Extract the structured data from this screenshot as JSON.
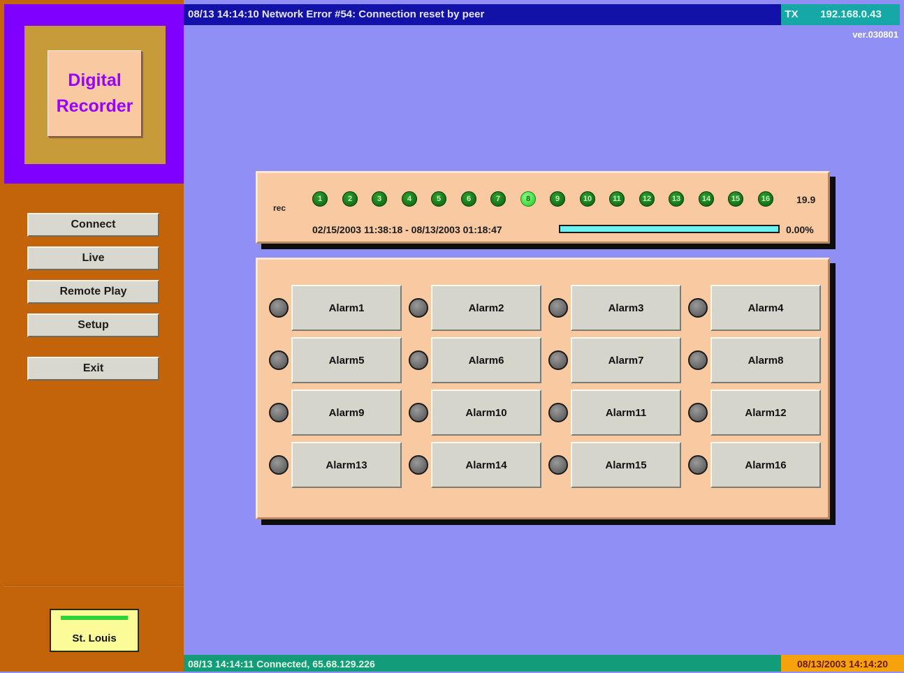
{
  "app": {
    "logo_line1": "Digital",
    "logo_line2": "Recorder",
    "version": "ver.030801"
  },
  "topbar": {
    "message": "08/13 14:14:10 Network Error #54: Connection reset by peer",
    "tx_label": "TX",
    "ip": "192.168.0.43"
  },
  "nav": {
    "connect": "Connect",
    "live": "Live",
    "remote_play": "Remote Play",
    "setup": "Setup",
    "exit": "Exit"
  },
  "site": {
    "name": "St. Louis",
    "status_color": "#2fd23a"
  },
  "recording": {
    "label": "rec",
    "channels": [
      "1",
      "2",
      "3",
      "4",
      "5",
      "6",
      "7",
      "8",
      "9",
      "10",
      "11",
      "12",
      "13",
      "14",
      "15",
      "16"
    ],
    "active_channel": "8",
    "rate": "19.9",
    "range": "02/15/2003 11:38:18 - 08/13/2003 01:18:47",
    "progress_fraction": 1.0,
    "progress_percent": "0.00%"
  },
  "alarms": {
    "labels": [
      "Alarm1",
      "Alarm2",
      "Alarm3",
      "Alarm4",
      "Alarm5",
      "Alarm6",
      "Alarm7",
      "Alarm8",
      "Alarm9",
      "Alarm10",
      "Alarm11",
      "Alarm12",
      "Alarm13",
      "Alarm14",
      "Alarm15",
      "Alarm16"
    ]
  },
  "bottombar": {
    "message": "08/13 14:14:11 Connected, 65.68.129.226",
    "clock": "08/13/2003 14:14:20"
  },
  "colors": {
    "background": "#8f8ff5",
    "sidebar": "#c4640a",
    "topbar": "#1212a8",
    "bottombar": "#129c79",
    "clock": "#f5a20c",
    "panel": "#f9c9a1",
    "channel_on": "#1fc21f",
    "channel_rec": "#0a5a0a"
  }
}
